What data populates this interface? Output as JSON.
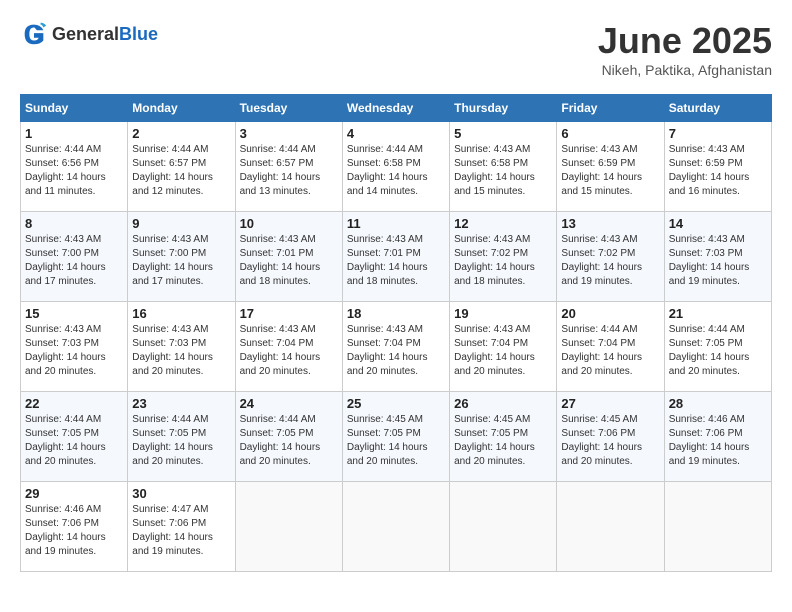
{
  "header": {
    "logo_general": "General",
    "logo_blue": "Blue",
    "title": "June 2025",
    "subtitle": "Nikeh, Paktika, Afghanistan"
  },
  "weekdays": [
    "Sunday",
    "Monday",
    "Tuesday",
    "Wednesday",
    "Thursday",
    "Friday",
    "Saturday"
  ],
  "weeks": [
    [
      {
        "day": "1",
        "sunrise": "Sunrise: 4:44 AM",
        "sunset": "Sunset: 6:56 PM",
        "daylight": "Daylight: 14 hours and 11 minutes."
      },
      {
        "day": "2",
        "sunrise": "Sunrise: 4:44 AM",
        "sunset": "Sunset: 6:57 PM",
        "daylight": "Daylight: 14 hours and 12 minutes."
      },
      {
        "day": "3",
        "sunrise": "Sunrise: 4:44 AM",
        "sunset": "Sunset: 6:57 PM",
        "daylight": "Daylight: 14 hours and 13 minutes."
      },
      {
        "day": "4",
        "sunrise": "Sunrise: 4:44 AM",
        "sunset": "Sunset: 6:58 PM",
        "daylight": "Daylight: 14 hours and 14 minutes."
      },
      {
        "day": "5",
        "sunrise": "Sunrise: 4:43 AM",
        "sunset": "Sunset: 6:58 PM",
        "daylight": "Daylight: 14 hours and 15 minutes."
      },
      {
        "day": "6",
        "sunrise": "Sunrise: 4:43 AM",
        "sunset": "Sunset: 6:59 PM",
        "daylight": "Daylight: 14 hours and 15 minutes."
      },
      {
        "day": "7",
        "sunrise": "Sunrise: 4:43 AM",
        "sunset": "Sunset: 6:59 PM",
        "daylight": "Daylight: 14 hours and 16 minutes."
      }
    ],
    [
      {
        "day": "8",
        "sunrise": "Sunrise: 4:43 AM",
        "sunset": "Sunset: 7:00 PM",
        "daylight": "Daylight: 14 hours and 17 minutes."
      },
      {
        "day": "9",
        "sunrise": "Sunrise: 4:43 AM",
        "sunset": "Sunset: 7:00 PM",
        "daylight": "Daylight: 14 hours and 17 minutes."
      },
      {
        "day": "10",
        "sunrise": "Sunrise: 4:43 AM",
        "sunset": "Sunset: 7:01 PM",
        "daylight": "Daylight: 14 hours and 18 minutes."
      },
      {
        "day": "11",
        "sunrise": "Sunrise: 4:43 AM",
        "sunset": "Sunset: 7:01 PM",
        "daylight": "Daylight: 14 hours and 18 minutes."
      },
      {
        "day": "12",
        "sunrise": "Sunrise: 4:43 AM",
        "sunset": "Sunset: 7:02 PM",
        "daylight": "Daylight: 14 hours and 18 minutes."
      },
      {
        "day": "13",
        "sunrise": "Sunrise: 4:43 AM",
        "sunset": "Sunset: 7:02 PM",
        "daylight": "Daylight: 14 hours and 19 minutes."
      },
      {
        "day": "14",
        "sunrise": "Sunrise: 4:43 AM",
        "sunset": "Sunset: 7:03 PM",
        "daylight": "Daylight: 14 hours and 19 minutes."
      }
    ],
    [
      {
        "day": "15",
        "sunrise": "Sunrise: 4:43 AM",
        "sunset": "Sunset: 7:03 PM",
        "daylight": "Daylight: 14 hours and 20 minutes."
      },
      {
        "day": "16",
        "sunrise": "Sunrise: 4:43 AM",
        "sunset": "Sunset: 7:03 PM",
        "daylight": "Daylight: 14 hours and 20 minutes."
      },
      {
        "day": "17",
        "sunrise": "Sunrise: 4:43 AM",
        "sunset": "Sunset: 7:04 PM",
        "daylight": "Daylight: 14 hours and 20 minutes."
      },
      {
        "day": "18",
        "sunrise": "Sunrise: 4:43 AM",
        "sunset": "Sunset: 7:04 PM",
        "daylight": "Daylight: 14 hours and 20 minutes."
      },
      {
        "day": "19",
        "sunrise": "Sunrise: 4:43 AM",
        "sunset": "Sunset: 7:04 PM",
        "daylight": "Daylight: 14 hours and 20 minutes."
      },
      {
        "day": "20",
        "sunrise": "Sunrise: 4:44 AM",
        "sunset": "Sunset: 7:04 PM",
        "daylight": "Daylight: 14 hours and 20 minutes."
      },
      {
        "day": "21",
        "sunrise": "Sunrise: 4:44 AM",
        "sunset": "Sunset: 7:05 PM",
        "daylight": "Daylight: 14 hours and 20 minutes."
      }
    ],
    [
      {
        "day": "22",
        "sunrise": "Sunrise: 4:44 AM",
        "sunset": "Sunset: 7:05 PM",
        "daylight": "Daylight: 14 hours and 20 minutes."
      },
      {
        "day": "23",
        "sunrise": "Sunrise: 4:44 AM",
        "sunset": "Sunset: 7:05 PM",
        "daylight": "Daylight: 14 hours and 20 minutes."
      },
      {
        "day": "24",
        "sunrise": "Sunrise: 4:44 AM",
        "sunset": "Sunset: 7:05 PM",
        "daylight": "Daylight: 14 hours and 20 minutes."
      },
      {
        "day": "25",
        "sunrise": "Sunrise: 4:45 AM",
        "sunset": "Sunset: 7:05 PM",
        "daylight": "Daylight: 14 hours and 20 minutes."
      },
      {
        "day": "26",
        "sunrise": "Sunrise: 4:45 AM",
        "sunset": "Sunset: 7:05 PM",
        "daylight": "Daylight: 14 hours and 20 minutes."
      },
      {
        "day": "27",
        "sunrise": "Sunrise: 4:45 AM",
        "sunset": "Sunset: 7:06 PM",
        "daylight": "Daylight: 14 hours and 20 minutes."
      },
      {
        "day": "28",
        "sunrise": "Sunrise: 4:46 AM",
        "sunset": "Sunset: 7:06 PM",
        "daylight": "Daylight: 14 hours and 19 minutes."
      }
    ],
    [
      {
        "day": "29",
        "sunrise": "Sunrise: 4:46 AM",
        "sunset": "Sunset: 7:06 PM",
        "daylight": "Daylight: 14 hours and 19 minutes."
      },
      {
        "day": "30",
        "sunrise": "Sunrise: 4:47 AM",
        "sunset": "Sunset: 7:06 PM",
        "daylight": "Daylight: 14 hours and 19 minutes."
      },
      null,
      null,
      null,
      null,
      null
    ]
  ]
}
